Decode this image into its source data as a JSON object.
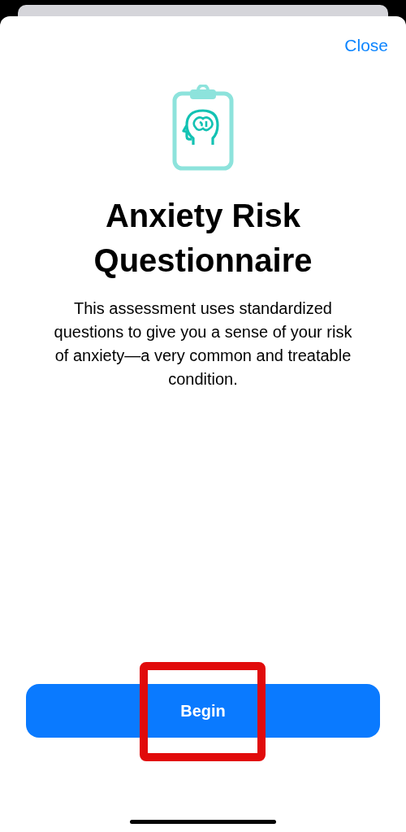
{
  "close_button": "Close",
  "title": "Anxiety Risk Questionnaire",
  "description": "This assessment uses standardized questions to give you a sense of your risk of anxiety—a very common and treatable condition.",
  "begin_button": "Begin"
}
